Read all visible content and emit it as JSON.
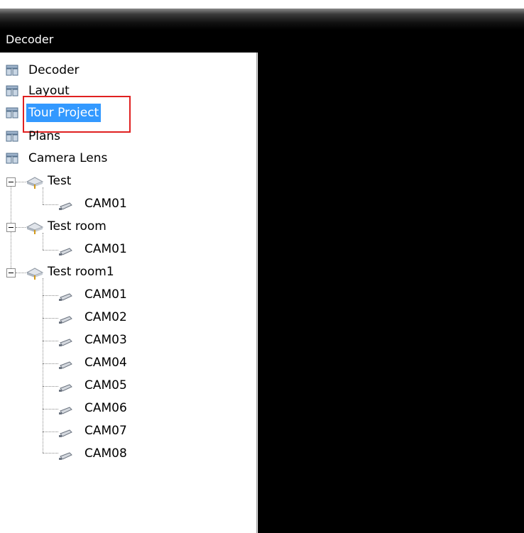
{
  "window": {
    "title": "Decoder"
  },
  "tree": {
    "top_items": [
      {
        "label": "Decoder"
      },
      {
        "label": "Layout"
      },
      {
        "label": "Tour Project",
        "selected": true
      },
      {
        "label": "Plans"
      },
      {
        "label": "Camera Lens"
      }
    ],
    "groups": [
      {
        "label": "Test",
        "expanded": true,
        "cameras": [
          "CAM01"
        ]
      },
      {
        "label": "Test room",
        "expanded": true,
        "cameras": [
          "CAM01"
        ]
      },
      {
        "label": "Test room1",
        "expanded": true,
        "cameras": [
          "CAM01",
          "CAM02",
          "CAM03",
          "CAM04",
          "CAM05",
          "CAM06",
          "CAM07",
          "CAM08"
        ]
      }
    ]
  },
  "colors": {
    "selection": "#3399ff",
    "highlight_box": "#e02020",
    "video_background": "#000000"
  },
  "icons": {
    "top_item": "decoder-group-icon",
    "group": "device-node-icon",
    "camera": "camera-icon"
  }
}
